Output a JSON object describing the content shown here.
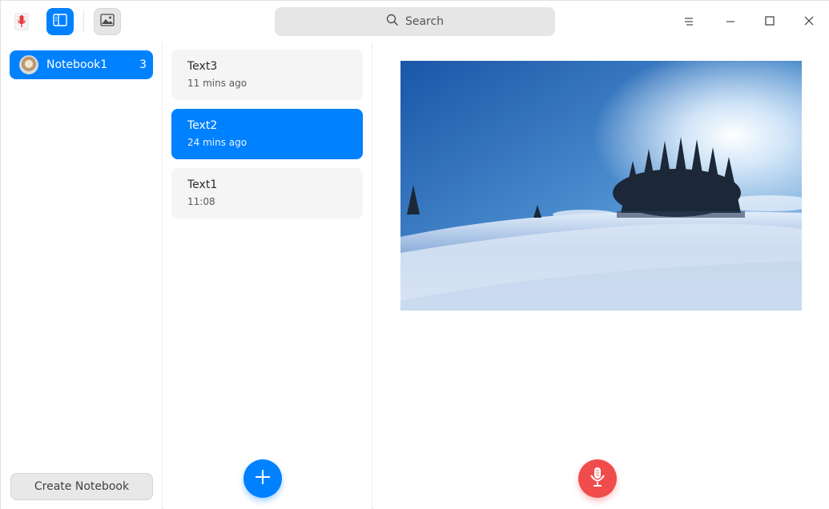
{
  "titlebar": {
    "app_icon": "microphone-app-icon",
    "sidebar_toggle_icon": "sidebar-icon",
    "insert_image_icon": "image-icon",
    "search": {
      "placeholder": "Search",
      "icon": "search-icon"
    },
    "window_controls": [
      "menu-icon",
      "minimize-icon",
      "maximize-icon",
      "close-icon"
    ]
  },
  "sidebar": {
    "notebooks": [
      {
        "label": "Notebook1",
        "count": "3",
        "selected": true
      }
    ],
    "create_label": "Create Notebook"
  },
  "notes": [
    {
      "title": "Text3",
      "time": "11 mins ago",
      "selected": false
    },
    {
      "title": "Text2",
      "time": "24 mins ago",
      "selected": true
    },
    {
      "title": "Text1",
      "time": "11:08",
      "selected": false
    }
  ],
  "actions": {
    "add_note_icon": "plus-icon",
    "record_icon": "microphone-icon"
  },
  "colors": {
    "accent": "#0081ff",
    "record": "#f04c4c"
  }
}
